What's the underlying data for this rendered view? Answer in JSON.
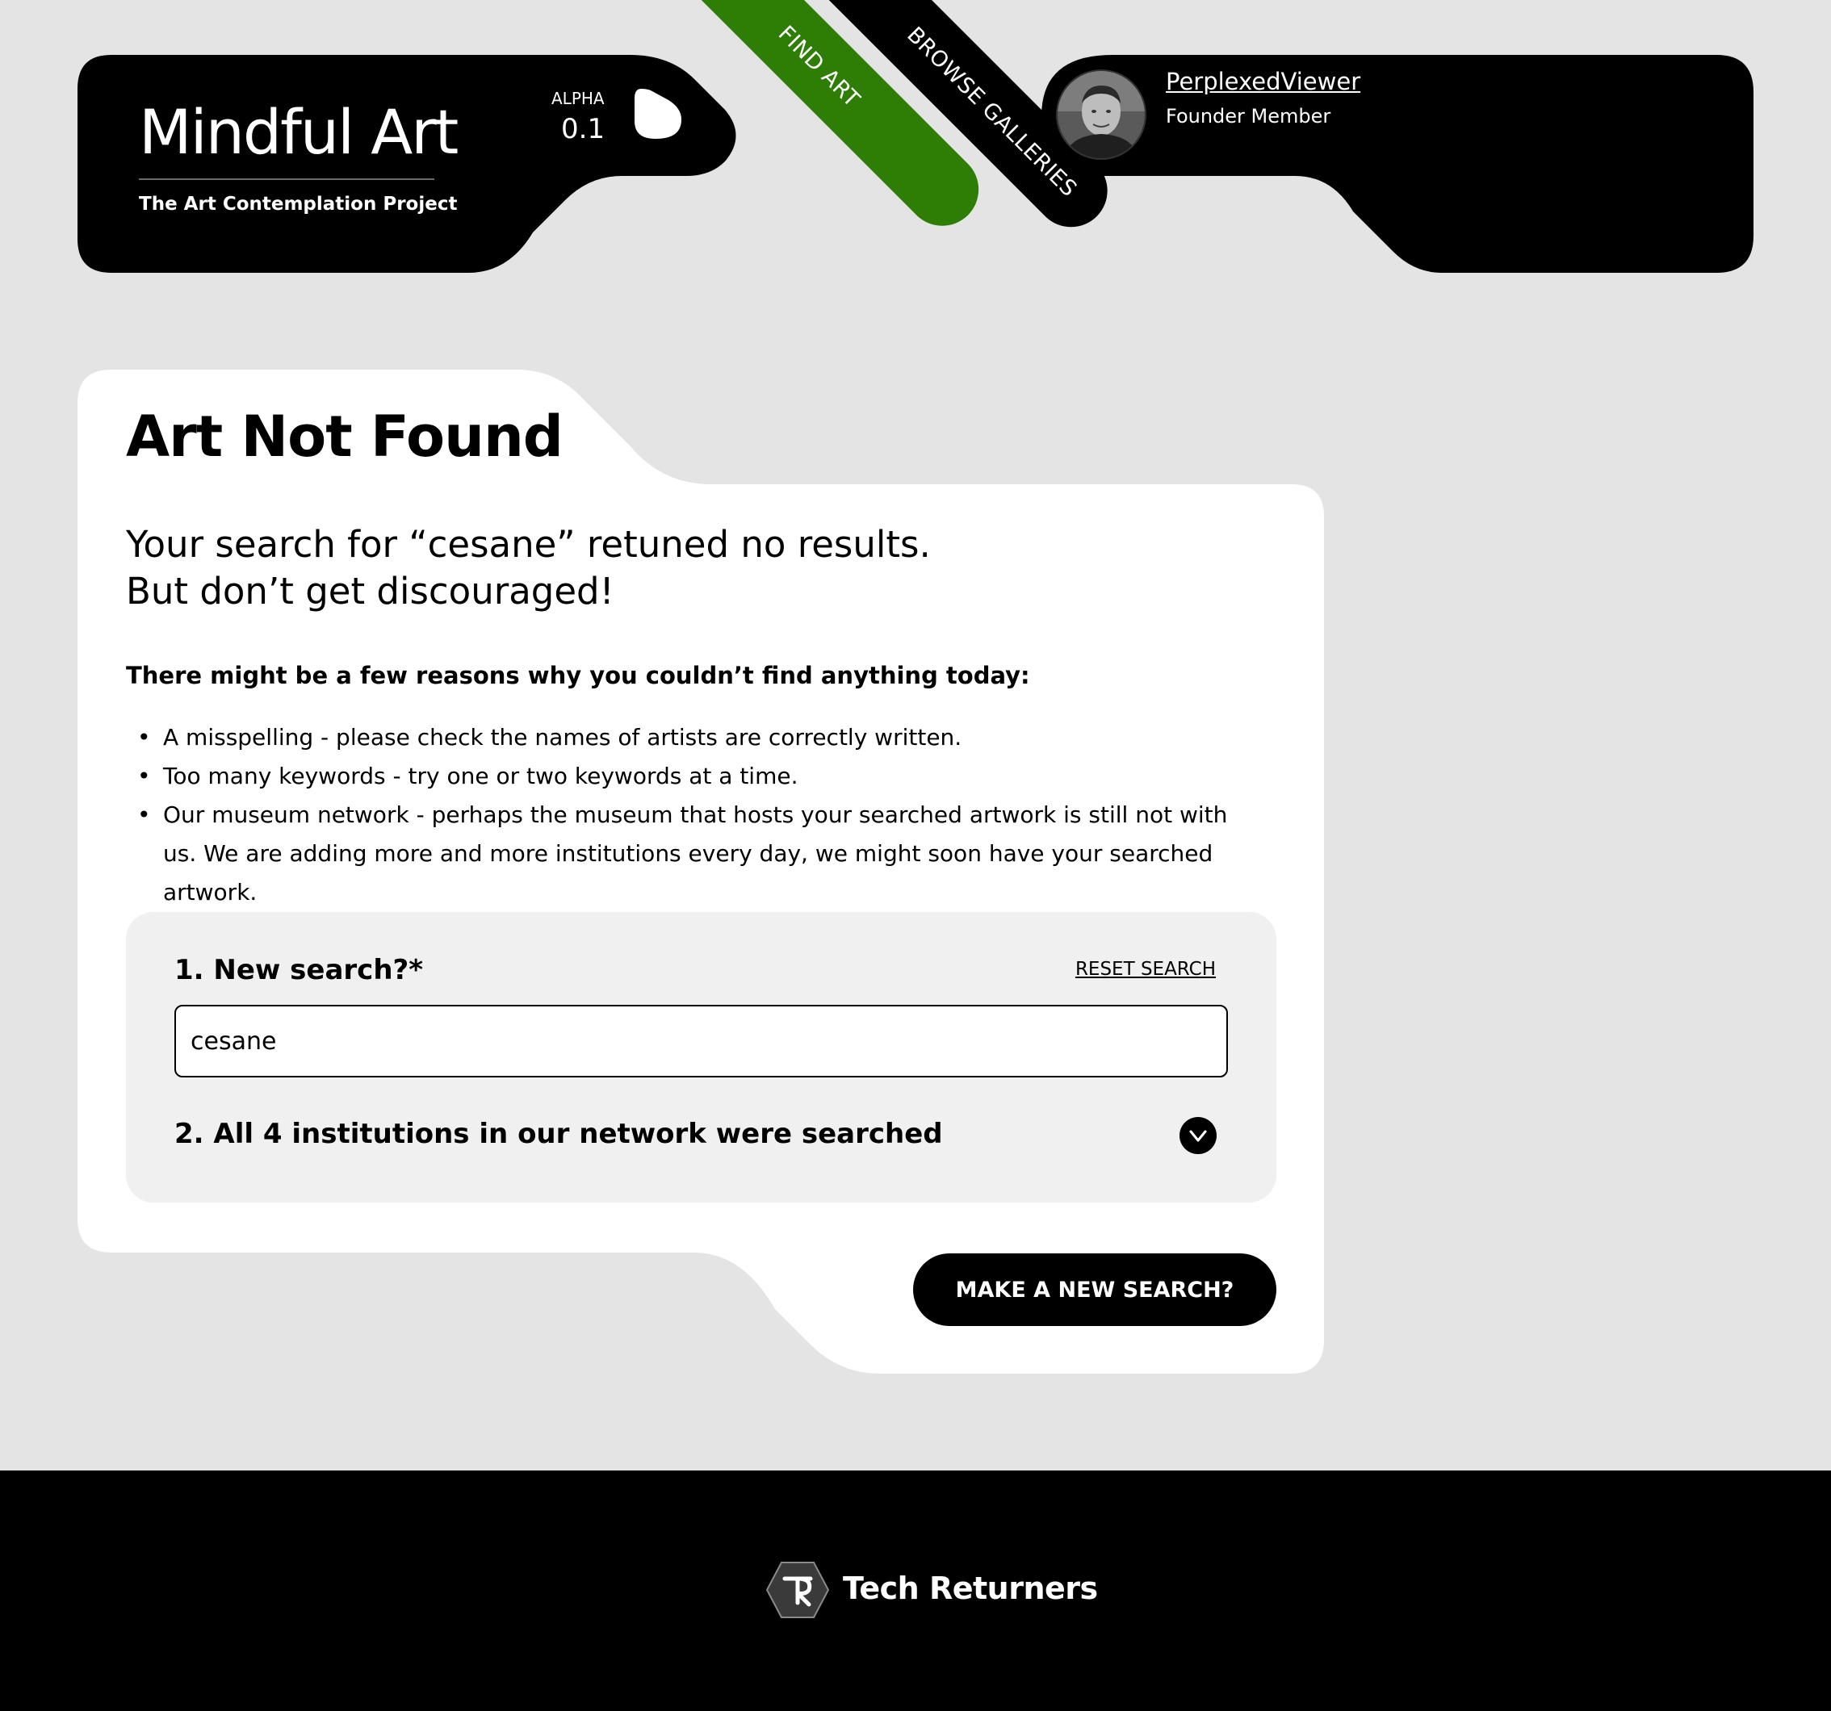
{
  "header": {
    "logo_title": "Mindful Art",
    "logo_subtitle": "The Art Contemplation Project",
    "version_label": "ALPHA",
    "version_number": "0.1",
    "nav": {
      "find_art": "FIND ART",
      "browse_galleries": "BROWSE GALLERIES"
    },
    "user": {
      "name": "PerplexedViewer",
      "role": "Founder Member"
    },
    "colors": {
      "accent_green": "#2e7d05",
      "panel_black": "#000000"
    }
  },
  "main": {
    "title": "Art Not Found",
    "lead_line1": "Your search for “cesane” retuned no results.",
    "lead_line2": "But don’t get discouraged!",
    "reasons_heading": "There might be a few reasons why you couldn’t find anything today:",
    "reasons": [
      "A misspelling - please check the names of artists are correctly written.",
      "Too many keywords - try one or two keywords at a time.",
      "Our museum network - perhaps the museum that hosts your searched artwork is still not with us. We are adding more and more institutions every day, we might soon have your searched artwork."
    ],
    "search_panel": {
      "new_search_label": "1. New search?*",
      "reset_label": "RESET SEARCH",
      "search_value": "cesane",
      "institutions_label": "2. All 4 institutions in our network were searched",
      "chevron_icon": "chevron-down-icon"
    },
    "cta_label": "MAKE A NEW SEARCH?"
  },
  "footer": {
    "brand": "Tech Returners"
  }
}
